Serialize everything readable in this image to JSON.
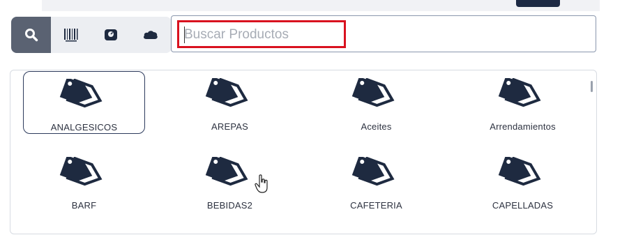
{
  "toolbar": {
    "buttons": [
      {
        "name": "search",
        "icon": "search-icon"
      },
      {
        "name": "barcode",
        "icon": "barcode-icon"
      },
      {
        "name": "scale",
        "icon": "scale-icon"
      },
      {
        "name": "cloud",
        "icon": "cloud-icon"
      }
    ]
  },
  "search": {
    "placeholder": "Buscar Productos",
    "value": ""
  },
  "categories": [
    {
      "label": "ANALGESICOS",
      "selected": true
    },
    {
      "label": "AREPAS",
      "selected": false
    },
    {
      "label": "Aceites",
      "selected": false
    },
    {
      "label": "Arrendamientos",
      "selected": false
    },
    {
      "label": "BARF",
      "selected": false
    },
    {
      "label": "BEBIDAS2",
      "selected": false
    },
    {
      "label": "CAFETERIA",
      "selected": false
    },
    {
      "label": "CAPELLADAS",
      "selected": false
    }
  ],
  "colors": {
    "accent_dark": "#1d2a44",
    "highlight_border": "#d9121f",
    "icon": "#1e2a40"
  }
}
